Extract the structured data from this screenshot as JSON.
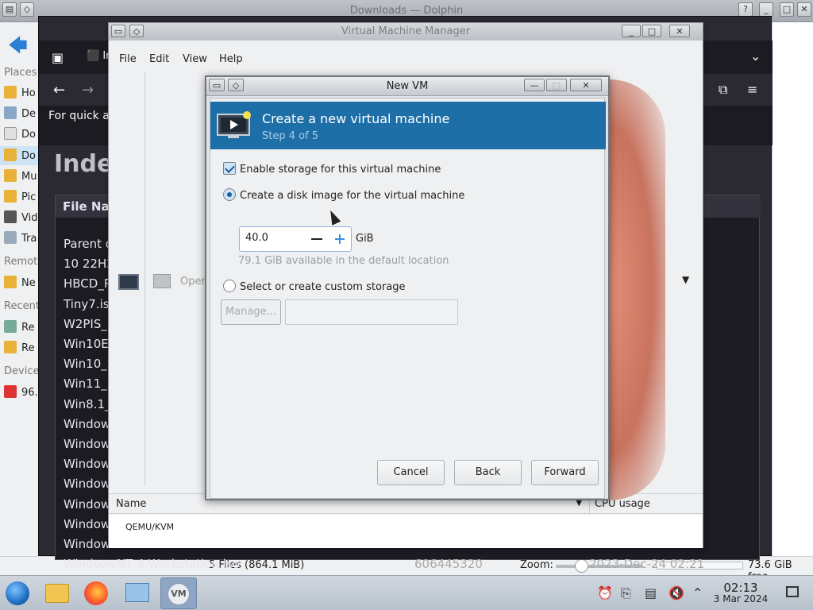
{
  "dolphin": {
    "title": "Downloads — Dolphin",
    "places": {
      "header_places": "Places",
      "items": [
        "Ho",
        "De",
        "Do",
        "Do",
        "Mu",
        "Pic",
        "Vid",
        "Tra"
      ],
      "header_remote": "Remote",
      "remote_items": [
        "Ne"
      ],
      "header_recent": "Recent",
      "recent_items": [
        "Re",
        "Re"
      ],
      "header_devices": "Devices",
      "device_items": [
        "96."
      ]
    },
    "status": {
      "files": "5 Files (864.1 MiB)",
      "zoom_label": "Zoom:",
      "free_space": "73.6 GiB free"
    }
  },
  "browser": {
    "tab_label": "In",
    "banner": "For quick ac",
    "index_title": "Index",
    "table_header": "File Nam",
    "rows": [
      "Parent d",
      "10 22H2",
      "HBCD_P",
      "Tiny7.iso",
      "W2PIS_E",
      "Win10Er",
      "Win10_2",
      "Win11_2",
      "Win8.1_",
      "Window",
      "Window",
      "Window",
      "Window",
      "Window",
      "Window",
      "Window",
      "WindowsNT 4 Workstation.iso"
    ],
    "last_row_size": "606445320",
    "last_row_date": "2023-Dec-24 02:21"
  },
  "vmm": {
    "title": "Virtual Machine Manager",
    "menu": [
      "File",
      "Edit",
      "View",
      "Help"
    ],
    "toolbar_open": "Open",
    "col_name": "Name",
    "col_cpu": "CPU usage",
    "connection": "QEMU/KVM"
  },
  "dialog": {
    "title": "New VM",
    "header_title": "Create a new virtual machine",
    "header_step": "Step 4 of 5",
    "enable_storage": "Enable storage for this virtual machine",
    "create_disk": "Create a disk image for the virtual machine",
    "disk_size": "40.0",
    "disk_unit": "GiB",
    "available": "79.1 GiB available in the default location",
    "custom_storage": "Select or create custom storage",
    "manage_button": "Manage...",
    "cancel_button": "Cancel",
    "back_button": "Back",
    "forward_button": "Forward"
  },
  "taskbar": {
    "time": "02:13",
    "date": "3 Mar 2024"
  }
}
